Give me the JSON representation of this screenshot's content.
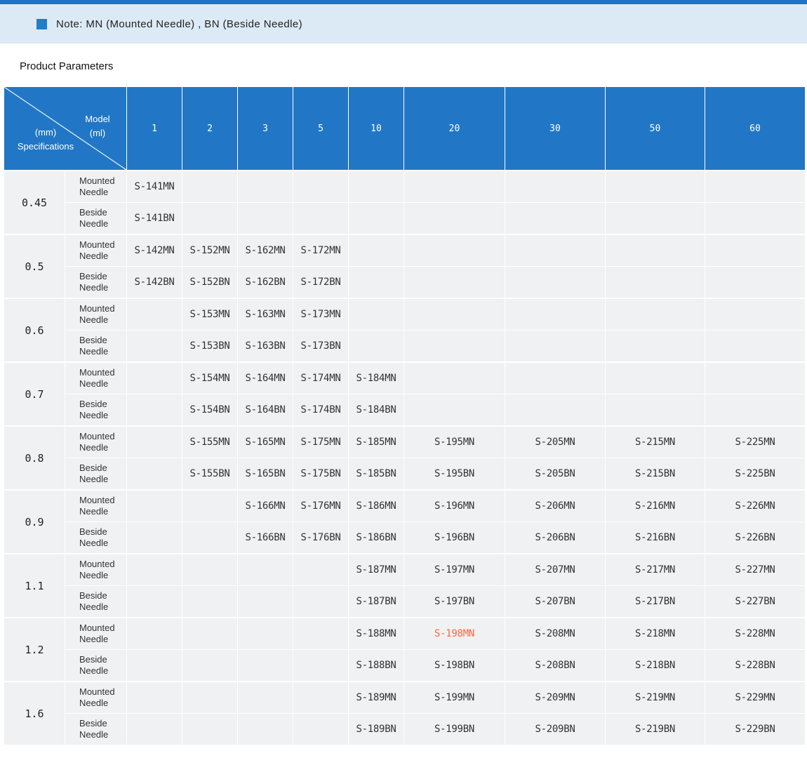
{
  "page": {
    "top_strip_color": "#1b74c6",
    "note_band_color": "#dceaf6",
    "background": "#ffffff"
  },
  "note": {
    "icon": "blue-square-bullet-icon",
    "icon_color": "#1d80c9",
    "text": "Note: MN (Mounted Needle) , BN (Beside Needle)"
  },
  "section": {
    "title": "Product Parameters"
  },
  "table": {
    "header_bg": "#2177c5",
    "cell_bg": "#f0f1f2",
    "highlight_color": "#ff6640",
    "highlighted_model": "S-198MN",
    "corner": {
      "model_label": "Model",
      "model_unit": "(ml)",
      "spec_unit": "(mm)",
      "spec_label": "Specifications"
    },
    "columns": [
      "1",
      "2",
      "3",
      "5",
      "10",
      "20",
      "30",
      "50",
      "60"
    ],
    "row_labels": {
      "mounted": [
        "Mounted",
        "Needle"
      ],
      "beside": [
        "Beside",
        "Needle"
      ]
    },
    "groups": [
      {
        "spec": "0.45",
        "mn": [
          "S-141MN",
          "",
          "",
          "",
          "",
          "",
          "",
          "",
          ""
        ],
        "bn": [
          "S-141BN",
          "",
          "",
          "",
          "",
          "",
          "",
          "",
          ""
        ]
      },
      {
        "spec": "0.5",
        "mn": [
          "S-142MN",
          "S-152MN",
          "S-162MN",
          "S-172MN",
          "",
          "",
          "",
          "",
          ""
        ],
        "bn": [
          "S-142BN",
          "S-152BN",
          "S-162BN",
          "S-172BN",
          "",
          "",
          "",
          "",
          ""
        ]
      },
      {
        "spec": "0.6",
        "mn": [
          "",
          "S-153MN",
          "S-163MN",
          "S-173MN",
          "",
          "",
          "",
          "",
          ""
        ],
        "bn": [
          "",
          "S-153BN",
          "S-163BN",
          "S-173BN",
          "",
          "",
          "",
          "",
          ""
        ]
      },
      {
        "spec": "0.7",
        "mn": [
          "",
          "S-154MN",
          "S-164MN",
          "S-174MN",
          "S-184MN",
          "",
          "",
          "",
          ""
        ],
        "bn": [
          "",
          "S-154BN",
          "S-164BN",
          "S-174BN",
          "S-184BN",
          "",
          "",
          "",
          ""
        ]
      },
      {
        "spec": "0.8",
        "mn": [
          "",
          "S-155MN",
          "S-165MN",
          "S-175MN",
          "S-185MN",
          "S-195MN",
          "S-205MN",
          "S-215MN",
          "S-225MN"
        ],
        "bn": [
          "",
          "S-155BN",
          "S-165BN",
          "S-175BN",
          "S-185BN",
          "S-195BN",
          "S-205BN",
          "S-215BN",
          "S-225BN"
        ]
      },
      {
        "spec": "0.9",
        "mn": [
          "",
          "",
          "S-166MN",
          "S-176MN",
          "S-186MN",
          "S-196MN",
          "S-206MN",
          "S-216MN",
          "S-226MN"
        ],
        "bn": [
          "",
          "",
          "S-166BN",
          "S-176BN",
          "S-186BN",
          "S-196BN",
          "S-206BN",
          "S-216BN",
          "S-226BN"
        ]
      },
      {
        "spec": "1.1",
        "mn": [
          "",
          "",
          "",
          "",
          "S-187MN",
          "S-197MN",
          "S-207MN",
          "S-217MN",
          "S-227MN"
        ],
        "bn": [
          "",
          "",
          "",
          "",
          "S-187BN",
          "S-197BN",
          "S-207BN",
          "S-217BN",
          "S-227BN"
        ]
      },
      {
        "spec": "1.2",
        "mn": [
          "",
          "",
          "",
          "",
          "S-188MN",
          "S-198MN",
          "S-208MN",
          "S-218MN",
          "S-228MN"
        ],
        "bn": [
          "",
          "",
          "",
          "",
          "S-188BN",
          "S-198BN",
          "S-208BN",
          "S-218BN",
          "S-228BN"
        ]
      },
      {
        "spec": "1.6",
        "mn": [
          "",
          "",
          "",
          "",
          "S-189MN",
          "S-199MN",
          "S-209MN",
          "S-219MN",
          "S-229MN"
        ],
        "bn": [
          "",
          "",
          "",
          "",
          "S-189BN",
          "S-199BN",
          "S-209BN",
          "S-219BN",
          "S-229BN"
        ]
      }
    ]
  }
}
